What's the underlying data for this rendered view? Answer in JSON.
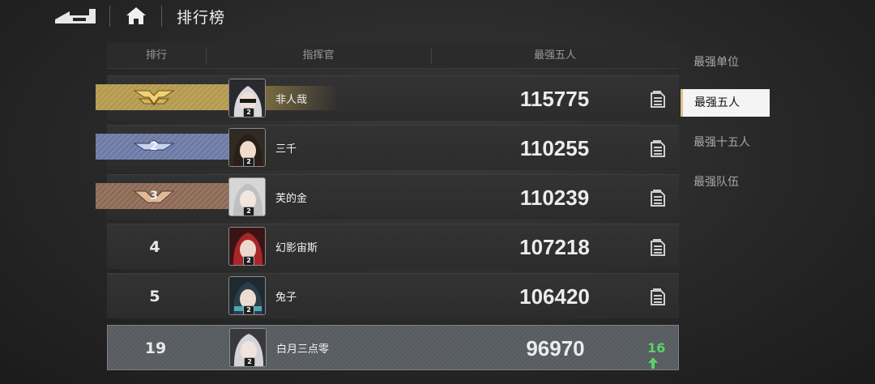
{
  "header": {
    "title": "排行榜",
    "back_icon": "back-arrow-icon",
    "home_icon": "home-icon"
  },
  "table": {
    "columns": [
      "排行",
      "指挥官",
      "最强五人"
    ]
  },
  "rows": [
    {
      "rank": "1",
      "badge": "gold",
      "name": "非人哉",
      "level": "2",
      "power": "115775",
      "detail_icon": "document-icon"
    },
    {
      "rank": "2",
      "badge": "blue",
      "name": "三千",
      "level": "2",
      "power": "110255",
      "detail_icon": "document-icon"
    },
    {
      "rank": "3",
      "badge": "bronze",
      "name": "芙的金",
      "level": "2",
      "power": "110239",
      "detail_icon": "document-icon"
    },
    {
      "rank": "4",
      "name": "幻影宙斯",
      "level": "2",
      "power": "107218",
      "detail_icon": "document-icon"
    },
    {
      "rank": "5",
      "name": "兔子",
      "level": "2",
      "power": "106420",
      "detail_icon": "document-icon"
    }
  ],
  "my_row": {
    "rank": "19",
    "name": "白月三点零",
    "level": "2",
    "power": "96970",
    "change": "16",
    "change_icon": "arrow-up-icon"
  },
  "sidebar": {
    "tabs": [
      {
        "label": "最强单位",
        "active": false
      },
      {
        "label": "最强五人",
        "active": true
      },
      {
        "label": "最强十五人",
        "active": false
      },
      {
        "label": "最强队伍",
        "active": false
      }
    ]
  },
  "colors": {
    "gold": "#b49a4e",
    "blue": "#6d7aa6",
    "bronze": "#8c6a55",
    "accent_green": "#58d26b",
    "active_tab_bg": "#f4f4f4"
  }
}
